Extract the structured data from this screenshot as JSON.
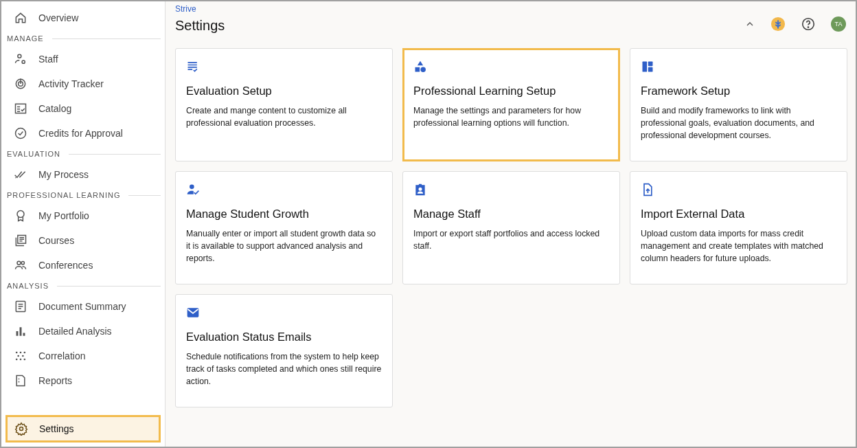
{
  "sidebar": {
    "items": [
      {
        "kind": "link",
        "label": "Overview",
        "selected": false
      },
      {
        "kind": "heading",
        "label": "MANAGE"
      },
      {
        "kind": "link",
        "label": "Staff",
        "selected": false
      },
      {
        "kind": "link",
        "label": "Activity Tracker",
        "selected": false
      },
      {
        "kind": "link",
        "label": "Catalog",
        "selected": false
      },
      {
        "kind": "link",
        "label": "Credits for Approval",
        "selected": false
      },
      {
        "kind": "heading",
        "label": "EVALUATION"
      },
      {
        "kind": "link",
        "label": "My Process",
        "selected": false
      },
      {
        "kind": "heading",
        "label": "PROFESSIONAL LEARNING"
      },
      {
        "kind": "link",
        "label": "My Portfolio",
        "selected": false
      },
      {
        "kind": "link",
        "label": "Courses",
        "selected": false
      },
      {
        "kind": "link",
        "label": "Conferences",
        "selected": false
      },
      {
        "kind": "heading",
        "label": "ANALYSIS"
      },
      {
        "kind": "link",
        "label": "Document Summary",
        "selected": false
      },
      {
        "kind": "link",
        "label": "Detailed Analysis",
        "selected": false
      },
      {
        "kind": "link",
        "label": "Correlation",
        "selected": false
      },
      {
        "kind": "link",
        "label": "Reports",
        "selected": false
      }
    ],
    "footer_item": {
      "label": "Settings",
      "selected": true
    }
  },
  "header": {
    "breadcrumb": "Strive",
    "title": "Settings",
    "avatar": "TA"
  },
  "cards": [
    {
      "title": "Evaluation Setup",
      "description": "Create and mange content to customize all professional evaluation processes.",
      "selected": false
    },
    {
      "title": "Professional Learning Setup",
      "description": "Manage the settings and parameters for how professional learning options will function.",
      "selected": true
    },
    {
      "title": "Framework Setup",
      "description": "Build and modify frameworks to link with professional goals, evaluation documents, and professional development courses.",
      "selected": false
    },
    {
      "title": "Manage Student Growth",
      "description": "Manually enter or import all student growth data so it is available to support advanced analysis and reports.",
      "selected": false
    },
    {
      "title": "Manage Staff",
      "description": "Import or export staff portfolios and access locked staff.",
      "selected": false
    },
    {
      "title": "Import External Data",
      "description": "Upload custom data imports for mass credit management and create templates with matched column headers for future uploads.",
      "selected": false
    },
    {
      "title": "Evaluation Status Emails",
      "description": "Schedule notifications from the system to help keep track of tasks completed and which ones still require action.",
      "selected": false
    }
  ]
}
